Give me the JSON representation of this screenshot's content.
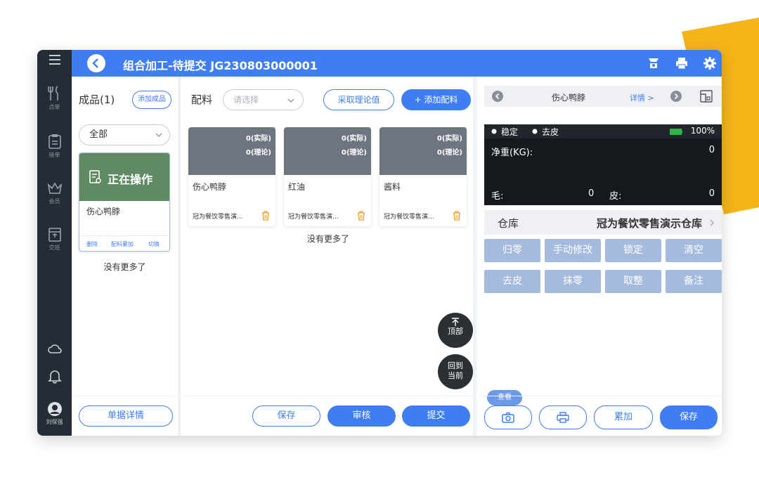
{
  "nav": {
    "items": [
      {
        "label": "点单"
      },
      {
        "label": "接单"
      },
      {
        "label": "会员"
      },
      {
        "label": "交班"
      }
    ],
    "user_label": "刘保强"
  },
  "header": {
    "title": "组合加工-待提交 JG230803000001"
  },
  "products": {
    "title": "成品(1)",
    "add_label": "添加成品",
    "filter_value": "全部",
    "card": {
      "banner": "正在操作",
      "name": "伤心鸭脖",
      "actions": [
        "删除",
        "配料累加",
        "切换"
      ]
    },
    "no_more": "没有更多了",
    "detail_button": "单据详情"
  },
  "ingredients": {
    "title": "配料",
    "select_placeholder": "请选择",
    "fetch_label": "采取理论值",
    "add_label": "+ 添加配料",
    "items": [
      {
        "actual": "0(实际)",
        "theory": "0(理论)",
        "name": "伤心鸭脖",
        "store": "冠为餐饮零售演..."
      },
      {
        "actual": "0(实际)",
        "theory": "0(理论)",
        "name": "红油",
        "store": "冠为餐饮零售演..."
      },
      {
        "actual": "0(实际)",
        "theory": "0(理论)",
        "name": "酱料",
        "store": "冠为餐饮零售演..."
      }
    ],
    "no_more": "没有更多了",
    "float_top": [
      "顶部"
    ],
    "float_current": [
      "回到",
      "当前"
    ],
    "save": "保存",
    "review": "审核",
    "submit": "提交"
  },
  "scale": {
    "product_name": "伤心鸭脖",
    "detail_link": "详情 >",
    "stable": "稳定",
    "tare_status": "去皮",
    "battery": "100%",
    "net_label": "净重(KG):",
    "net_value": "0",
    "gross_label": "毛:",
    "gross_value": "0",
    "tare_label": "皮:",
    "tare_value": "0",
    "warehouse_label": "仓库",
    "warehouse_value": "冠为餐饮零售演示仓库",
    "buttons": [
      "归零",
      "手动修改",
      "锁定",
      "清空",
      "去皮",
      "抹零",
      "取整",
      "备注"
    ],
    "view_label": "查看",
    "accumulate": "累加",
    "save": "保存"
  },
  "colors": {
    "primary": "#3f7ef2",
    "nav_bg": "#252c35",
    "active_green": "#5f8a62",
    "accent_yellow": "#f5b417",
    "gray_button": "#a5bbdd"
  }
}
